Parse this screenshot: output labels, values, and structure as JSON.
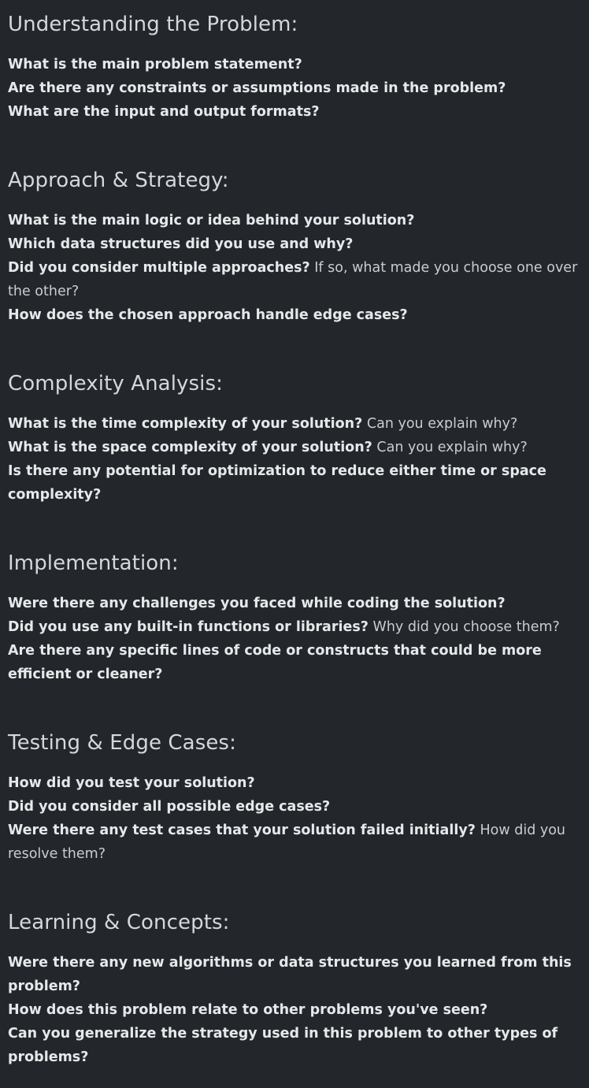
{
  "sections": [
    {
      "title": "Understanding the Problem:",
      "items": [
        {
          "q": "What is the main problem statement?",
          "rest": ""
        },
        {
          "q": "Are there any constraints or assumptions made in the problem?",
          "rest": ""
        },
        {
          "q": "What are the input and output formats?",
          "rest": ""
        }
      ]
    },
    {
      "title": "Approach & Strategy:",
      "items": [
        {
          "q": "What is the main logic or idea behind your solution?",
          "rest": ""
        },
        {
          "q": "Which data structures did you use and why?",
          "rest": ""
        },
        {
          "q": "Did you consider multiple approaches?",
          "rest": "If so, what made you choose one over the other?"
        },
        {
          "q": "How does the chosen approach handle edge cases?",
          "rest": ""
        }
      ]
    },
    {
      "title": "Complexity Analysis:",
      "items": [
        {
          "q": "What is the time complexity of your solution?",
          "rest": "Can you explain why?"
        },
        {
          "q": "What is the space complexity of your solution?",
          "rest": "Can you explain why?"
        },
        {
          "q": "Is there any potential for optimization to reduce either time or space complexity?",
          "rest": ""
        }
      ]
    },
    {
      "title": "Implementation:",
      "items": [
        {
          "q": "Were there any challenges you faced while coding the solution?",
          "rest": ""
        },
        {
          "q": "Did you use any built-in functions or libraries?",
          "rest": "Why did you choose them?"
        },
        {
          "q": "Are there any specific lines of code or constructs that could be more efficient or cleaner?",
          "rest": ""
        }
      ]
    },
    {
      "title": "Testing & Edge Cases:",
      "items": [
        {
          "q": "How did you test your solution?",
          "rest": ""
        },
        {
          "q": "Did you consider all possible edge cases?",
          "rest": ""
        },
        {
          "q": "Were there any test cases that your solution failed initially?",
          "rest": "How did you resolve them?"
        }
      ]
    },
    {
      "title": "Learning & Concepts:",
      "items": [
        {
          "q": "Were there any new algorithms or data structures you learned from this problem?",
          "rest": ""
        },
        {
          "q": "How does this problem relate to other problems you've seen?",
          "rest": ""
        },
        {
          "q": "Can you generalize the strategy used in this problem to other types of problems?",
          "rest": ""
        }
      ]
    }
  ]
}
